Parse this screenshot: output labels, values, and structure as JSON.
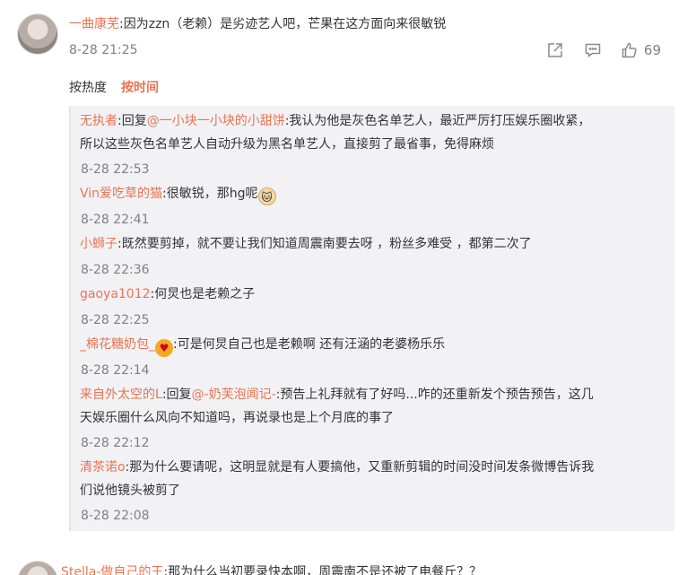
{
  "comment": {
    "author": "一曲康芜",
    "text": ":因为zzn（老赖）是劣迹艺人吧，芒果在这方面向来很敏锐",
    "time": "8-28 21:25",
    "like_count": "69",
    "icons": [
      "share-icon",
      "comment-icon",
      "like-icon"
    ]
  },
  "sort": {
    "hot_label": "按热度",
    "time_label": "按时间"
  },
  "replies": [
    {
      "author": "无执者",
      "text_pre": ":回复",
      "mention": "@一小块一小块的小甜饼",
      "text": ":我认为他是灰色名单艺人，最近严厉打压娱乐圈收紧，",
      "text2": "所以这些灰色名单艺人自动升级为黑名单艺人，直接剪了最省事，免得麻烦",
      "time": "8-28 22:53"
    },
    {
      "author": "Vin爱吃草的猫",
      "text": ":很敏锐，那hg呢",
      "emoji": "cat-emoji",
      "time": "8-28 22:41"
    },
    {
      "author": "小蛳子",
      "text": ":既然要剪掉，就不要让我们知道周震南要去呀 ，粉丝多难受 ，都第二次了",
      "time": "8-28 22:36"
    },
    {
      "author": "gaoya1012",
      "text": ":何炅也是老赖之子",
      "time": "8-28 22:25"
    },
    {
      "author": "_棉花糖奶包_",
      "text": ":可是何炅自己也是老赖啊 还有汪涵的老婆杨乐乐",
      "emoji": "love-emoji",
      "time": "8-28 22:14"
    },
    {
      "author": "来自外太空的L",
      "text_pre": ":回复",
      "mention": "@-奶芙泡闻记-",
      "text": ":预告上礼拜就有了好吗...咋的还重新发个预告预告，这几",
      "text2": "天娱乐圈什么风向不知道吗，再说录也是上个月底的事了",
      "time": "8-28 22:12"
    },
    {
      "author": "清茶诺o",
      "text": ":那为什么要请呢，这明显就是有人要搞他，又重新剪辑的时间没时间发条微博告诉我",
      "text2": "们说他镜头被剪了",
      "time": "8-28 22:08"
    }
  ],
  "next_comment": {
    "author": "Stella-做自己的王",
    "text": ":那为什么当初要录快本啊，周震南不是还被了电餐斤？？"
  },
  "colors": {
    "accent": "#eb7350",
    "meta": "#808080",
    "reply_bg": "#f2f2f5"
  }
}
